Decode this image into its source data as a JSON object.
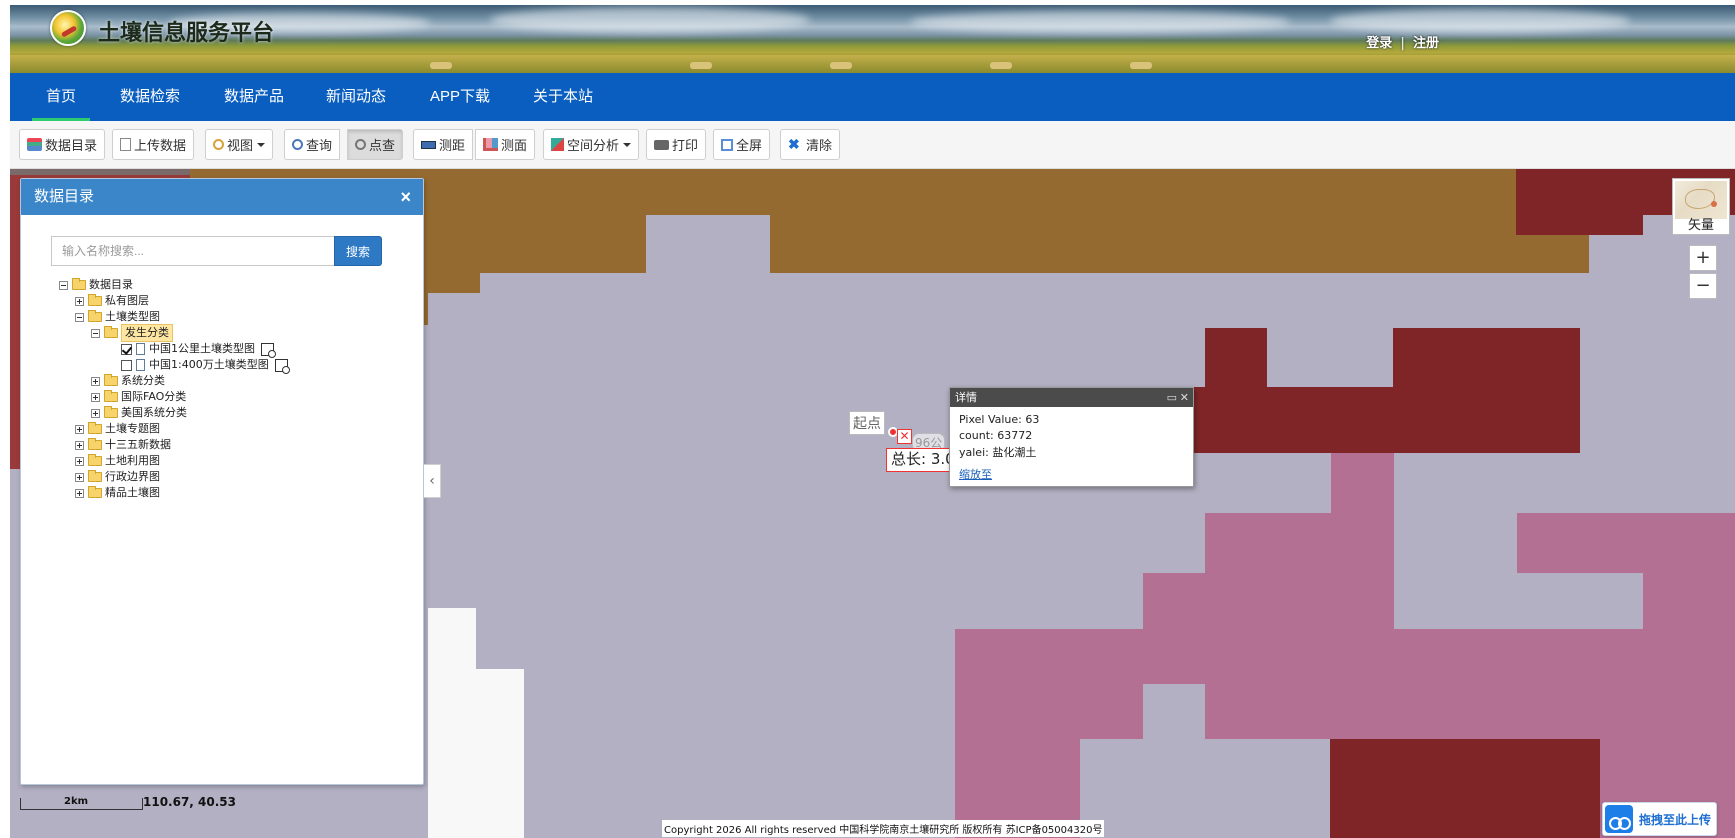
{
  "header": {
    "site_title": "土壤信息服务平台",
    "login": "登录",
    "divider": "|",
    "register": "注册"
  },
  "nav": {
    "items": [
      {
        "label": "首页",
        "active": true
      },
      {
        "label": "数据检索"
      },
      {
        "label": "数据产品"
      },
      {
        "label": "新闻动态"
      },
      {
        "label": "APP下载"
      },
      {
        "label": "关于本站"
      }
    ]
  },
  "toolbar": {
    "catalog": "数据目录",
    "upload": "上传数据",
    "view": "视图",
    "query": "查询",
    "point_query": "点查",
    "measure_distance": "测距",
    "measure_area": "测面",
    "spatial_analysis": "空间分析",
    "print": "打印",
    "fullscreen": "全屏",
    "clear": "清除"
  },
  "catalog_panel": {
    "title": "数据目录",
    "close": "×",
    "search_placeholder": "输入名称搜索...",
    "search_button": "搜索",
    "tree": [
      {
        "label": "数据目录",
        "level": 0,
        "expanded": true
      },
      {
        "label": "私有图层",
        "level": 1
      },
      {
        "label": "土壤类型图",
        "level": 1,
        "expanded": true
      },
      {
        "label": "发生分类",
        "level": 2,
        "expanded": true,
        "selected": true
      },
      {
        "label": "中国1公里土壤类型图",
        "level": 3,
        "checked": true
      },
      {
        "label": "中国1:400万土壤类型图",
        "level": 3,
        "checked": false
      },
      {
        "label": "系统分类",
        "level": 2
      },
      {
        "label": "国际FAO分类",
        "level": 2
      },
      {
        "label": "美国系统分类",
        "level": 2
      },
      {
        "label": "土壤专题图",
        "level": 1
      },
      {
        "label": "十三五新数据",
        "level": 1
      },
      {
        "label": "土地利用图",
        "level": 1
      },
      {
        "label": "行政边界图",
        "level": 1
      },
      {
        "label": "精品土壤图",
        "level": 1
      }
    ]
  },
  "popup": {
    "title": "详情",
    "pixel_value": "Pixel Value: 63",
    "count": "count: 63772",
    "yalei": "yalei: 盐化潮土",
    "zoom_link": "缩放至"
  },
  "measure": {
    "start_label": "起点",
    "segment_label": "96公",
    "total_label": "总长: 3.0"
  },
  "basemap": {
    "label": "矢量"
  },
  "zoom": {
    "in": "+",
    "out": "−"
  },
  "scale": {
    "label": "2km"
  },
  "coordinates": "110.67, 40.53",
  "copyright": "Copyright 2026 All rights reserved 中国科学院南京土壤研究所 版权所有 苏ICP备05004320号",
  "upload_widget": {
    "label": "拖拽至此上传"
  },
  "colors": {
    "nav": "#0a5ec0",
    "brown_zone": "#946a30",
    "maroon_zone": "#7f2527",
    "pink_zone": "#b47092",
    "gray_zone": "#b2b0c2"
  }
}
